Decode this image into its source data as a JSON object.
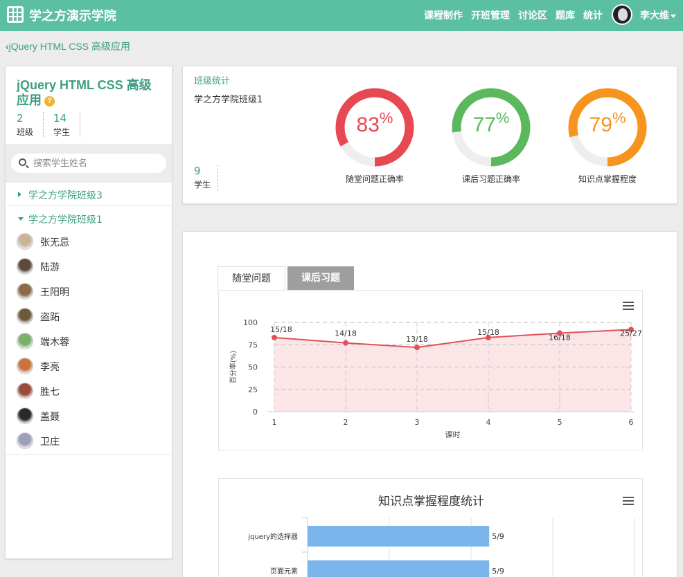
{
  "app": {
    "brand": "学之方演示学院",
    "logo_icon": "grid-logo-icon"
  },
  "nav": {
    "items": [
      "课程制作",
      "开班管理",
      "讨论区",
      "题库",
      "统计"
    ],
    "user": "李大维"
  },
  "breadcrumb": {
    "back_label": "jQuery HTML CSS 高级应用"
  },
  "sidebar": {
    "course_title": "jQuery HTML CSS 高级应用",
    "help_glyph": "?",
    "stats": [
      {
        "num": "2",
        "label": "班级"
      },
      {
        "num": "14",
        "label": "学生"
      }
    ],
    "search_placeholder": "搜索学生姓名",
    "classes": [
      {
        "name": "学之方学院班级3",
        "expanded": false
      },
      {
        "name": "学之方学院班级1",
        "expanded": true
      }
    ],
    "students": [
      {
        "name": "张无忌",
        "color": "#c9b49a"
      },
      {
        "name": "陆游",
        "color": "#5a4a3a"
      },
      {
        "name": "王阳明",
        "color": "#8a6a4a"
      },
      {
        "name": "盗跖",
        "color": "#6a5a3a"
      },
      {
        "name": "端木蓉",
        "color": "#7ab06a"
      },
      {
        "name": "李亮",
        "color": "#c8743a"
      },
      {
        "name": "胜七",
        "color": "#9a4a3a"
      },
      {
        "name": "盖聂",
        "color": "#2a2a2a"
      },
      {
        "name": "卫庄",
        "color": "#9aa0b8"
      }
    ]
  },
  "class_stats": {
    "title": "班级统计",
    "class_name": "学之方学院班级1",
    "students_num": "9",
    "students_label": "学生",
    "rings": [
      {
        "value": 83,
        "label": "随堂问题正确率",
        "color": "#e8484f"
      },
      {
        "value": 77,
        "label": "课后习题正确率",
        "color": "#5cb85c"
      },
      {
        "value": 79,
        "label": "知识点掌握程度",
        "color": "#f7941d"
      }
    ],
    "percent_sign": "%"
  },
  "tabs": {
    "active": "随堂问题",
    "inactive": "课后习题"
  },
  "chart_data": [
    {
      "type": "area",
      "x": [
        1,
        2,
        3,
        4,
        5,
        6
      ],
      "values": [
        83,
        77,
        72,
        83,
        88,
        92
      ],
      "point_labels": [
        "15/18",
        "14/18",
        "13/18",
        "15/18",
        "16/18",
        "25/27"
      ],
      "xlabel": "课时",
      "ylabel": "百分率(%)",
      "ylim": [
        0,
        100
      ],
      "yticks": [
        0,
        25,
        50,
        75,
        100
      ],
      "color": "#e0525a",
      "grid": true
    },
    {
      "type": "bar",
      "title": "知识点掌握程度统计",
      "categories": [
        "jquery的选择器",
        "页面元素"
      ],
      "values": [
        5,
        5
      ],
      "value_labels": [
        "5/9",
        "5/9"
      ],
      "max": 9,
      "color": "#7cb5ec"
    }
  ]
}
